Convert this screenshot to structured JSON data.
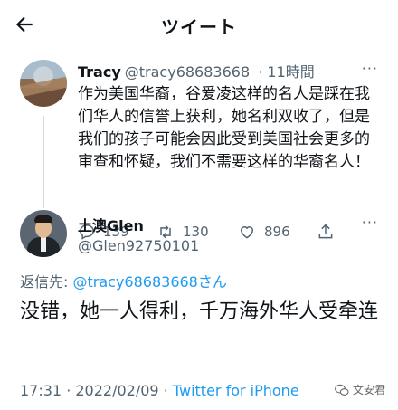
{
  "header": {
    "title": "ツイート"
  },
  "tweet": {
    "name": "Tracy",
    "handle": "@tracy68683668",
    "time": "· 11時間",
    "more": "···",
    "text": "作为美国华裔，谷爱凌这样的名人是踩在我们华人的信誉上获利，她名利双收了，但是我们的孩子可能会因此受到美国社会更多的审查和怀疑，我们不需要这样的华裔名人！",
    "actions": {
      "replies": "139",
      "retweets": "130",
      "likes": "896"
    }
  },
  "reply": {
    "name": "土澳Glen",
    "handle": "@Glen92750101",
    "reply_to_label": "返信先:",
    "reply_to_handle": "@tracy68683668さん",
    "text": "没错，她一人得利，千万海外华人受牵连",
    "time": "17:31 · 2022/02/09 ·",
    "source": "Twitter for iPhone"
  },
  "watermark": {
    "text": "文安君"
  },
  "colors": {
    "accent": "#1d9bf0",
    "muted": "#536471",
    "text": "#0f1419"
  }
}
